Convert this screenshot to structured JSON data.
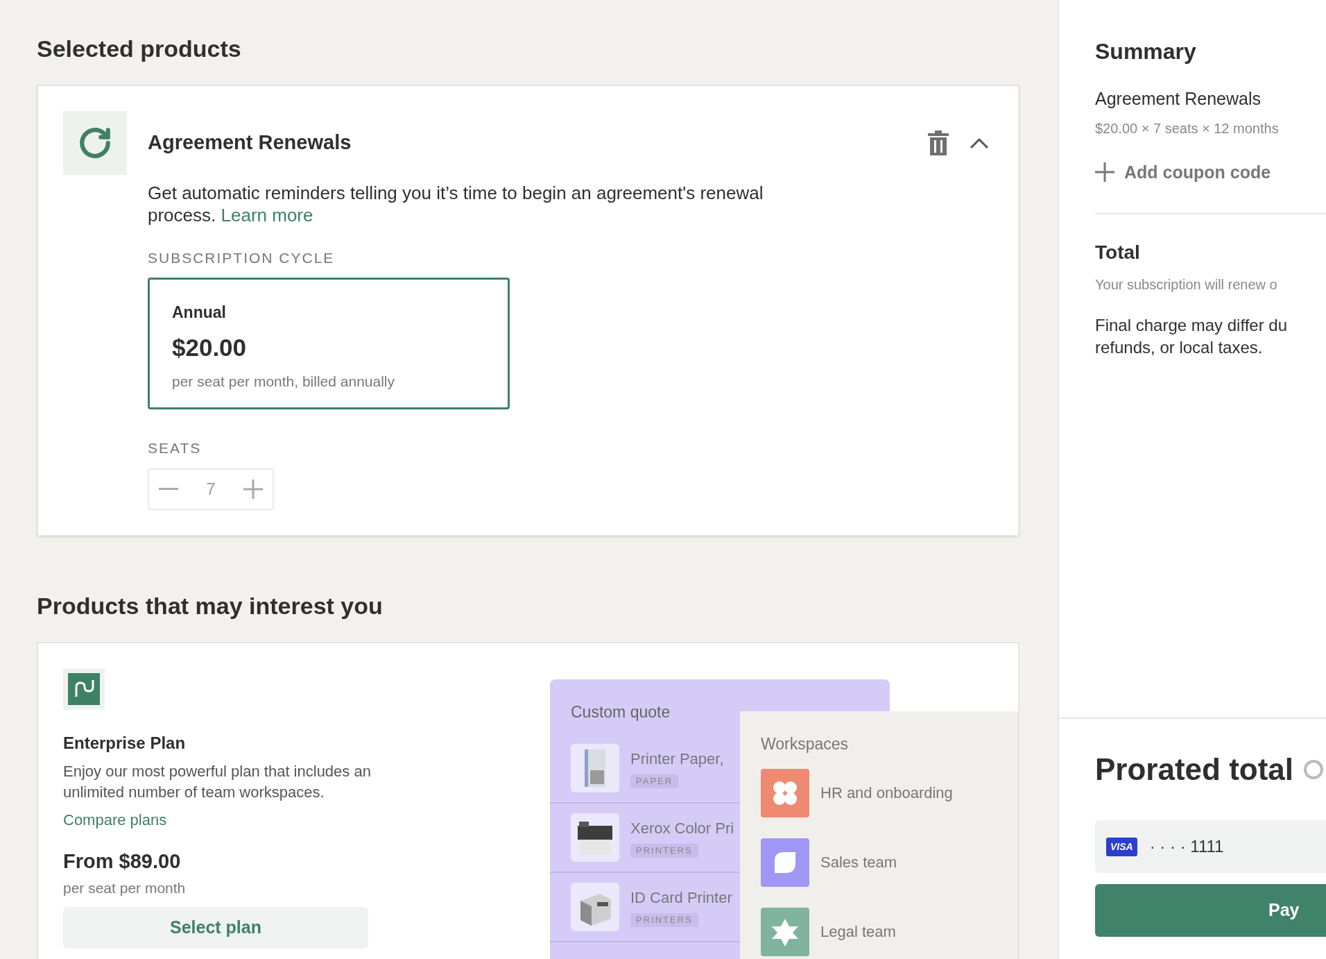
{
  "selected_products": {
    "heading": "Selected products",
    "product": {
      "title": "Agreement Renewals",
      "expanded": true,
      "description": "Get automatic reminders telling you it’s time to begin an agreement's renewal process.",
      "learn_more": "Learn more",
      "cycle_label": "SUBSCRIPTION CYCLE",
      "cycles": [
        {
          "name": "Annual",
          "price": "$20.00",
          "note": "per seat per month, billed annually",
          "selected": true
        }
      ],
      "seats_label": "SEATS",
      "seats": "7"
    }
  },
  "recommendations": {
    "heading": "Products that may interest you",
    "plan": {
      "title": "Enterprise Plan",
      "description": "Enjoy our most powerful plan that includes an unlimited number of team workspaces.",
      "compare": "Compare plans",
      "price": "From $89.00",
      "price_note": "per seat per month",
      "button": "Select plan"
    },
    "preview": {
      "quote_title": "Custom quote",
      "quote_items": [
        {
          "name": "Printer Paper,",
          "tag": "PAPER"
        },
        {
          "name": "Xerox Color Pri",
          "tag": "PRINTERS"
        },
        {
          "name": "ID Card Printer",
          "tag": "PRINTERS"
        }
      ],
      "workspaces_title": "Workspaces",
      "workspaces": [
        {
          "name": "HR and onboarding",
          "color": "#ee8a72",
          "kind": "clover"
        },
        {
          "name": "Sales team",
          "color": "#a097f4",
          "kind": "leaf"
        },
        {
          "name": "Legal team",
          "color": "#7fb3a0",
          "kind": "star"
        }
      ]
    }
  },
  "summary": {
    "title": "Summary",
    "item": "Agreement Renewals",
    "item_detail": "$20.00 × 7 seats × 12 months",
    "coupon": "Add coupon code",
    "total_title": "Total",
    "renew_note": "Your subscription will renew o",
    "charge_note": "Final charge may differ du refunds, or local taxes.",
    "prorated_title": "Prorated total",
    "card_brand": "VISA",
    "card_number": "· · · · 1111",
    "pay_button": "Pay"
  }
}
